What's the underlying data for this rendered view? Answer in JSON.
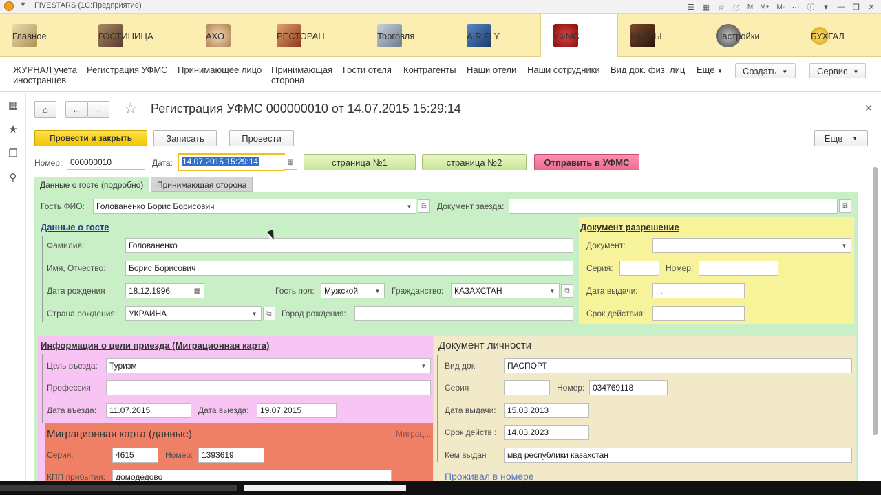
{
  "window": {
    "title": "FIVESTARS (1С:Предприятие)",
    "title_icons": [
      "nav-icon",
      "calendar-icon",
      "star-icon",
      "history-icon",
      "M",
      "M+",
      "M-",
      "ellipsis-icon",
      "info-icon",
      "dropdown-icon",
      "minimize-icon",
      "restore-icon",
      "close-icon"
    ]
  },
  "sections": [
    {
      "label": "Главное",
      "icon": "home-desk-icon",
      "color": "#c8b070"
    },
    {
      "label": "ГОСТИНИЦА",
      "icon": "hotel-icon",
      "color": "#8a6a4a"
    },
    {
      "label": "АХО",
      "icon": "maid-icon",
      "color": "#d9b890"
    },
    {
      "label": "РЕСТОРАН",
      "icon": "dish-icon",
      "color": "#b0603a"
    },
    {
      "label": "Торговля",
      "icon": "store-icon",
      "color": "#8c9aa8"
    },
    {
      "label": "AIR FLY",
      "icon": "plane-icon",
      "color": "#2a5a9a"
    },
    {
      "label": "УФМС",
      "icon": "emblem-icon",
      "color": "#b02020",
      "active": true
    },
    {
      "label": "КАДРЫ",
      "icon": "book-icon",
      "color": "#5a2a1a"
    },
    {
      "label": "Настройки",
      "icon": "gear-icon",
      "color": "#606060"
    },
    {
      "label": "БУХГАЛ",
      "icon": "coin-icon",
      "color": "#e0b020"
    }
  ],
  "nav": {
    "items": [
      {
        "label": "ЖУРНАЛ учета иностранцев"
      },
      {
        "label": "Регистрация УФМС"
      },
      {
        "label": "Принимающее лицо"
      },
      {
        "label": "Принимающая сторона"
      },
      {
        "label": "Гости отеля"
      },
      {
        "label": "Контрагенты"
      },
      {
        "label": "Наши отели"
      },
      {
        "label": "Наши сотрудники"
      },
      {
        "label": "Вид док. физ. лиц"
      }
    ],
    "more_label": "Еще",
    "create_label": "Создать",
    "service_label": "Сервис"
  },
  "rail": [
    "apps-grid-icon",
    "favorites-star-icon",
    "history-icon",
    "search-icon"
  ],
  "form": {
    "title": "Регистрация УФМС 000000010 от 14.07.2015 15:29:14",
    "buttons": {
      "post_close": "Провести и закрыть",
      "save": "Записать",
      "post": "Провести",
      "more": "Еще",
      "page1": "страница №1",
      "page2": "страница №2",
      "send": "Отправить в УФМС"
    },
    "number_label": "Номер:",
    "number_value": "000000010",
    "date_label": "Дата:",
    "date_value": "14.07.2015 15:29:14",
    "tabs": [
      "Данные о госте (подробно)",
      "Принимающая сторона"
    ],
    "guest_label": "Гость ФИО:",
    "guest_value": "Голованенко Борис Борисович",
    "arrival_doc_label": "Документ заезда:",
    "arrival_doc_value": "",
    "guest_section": {
      "title": "Данные о госте",
      "lastname_label": "Фамилия:",
      "lastname_value": "Голованенко",
      "name_label": "Имя, Отчество:",
      "name_value": "Борис Борисович",
      "birthdate_label": "Дата рождения",
      "birthdate_value": "18.12.1996",
      "gender_label": "Гость пол:",
      "gender_value": "Мужской",
      "citizenship_label": "Гражданство:",
      "citizenship_value": "КАЗАХСТАН",
      "birth_country_label": "Страна рождения:",
      "birth_country_value": "УКРАИНА",
      "birth_city_label": "Город рождения:",
      "birth_city_value": ""
    },
    "permit_section": {
      "title": "Документ разрешение",
      "doc_label": "Документ:",
      "doc_value": "",
      "series_label": "Серия:",
      "series_value": "",
      "number_label": "Номер:",
      "number_value": "",
      "issue_label": "Дата выдачи:",
      "issue_value": " .  . ",
      "valid_label": "Срок действия:",
      "valid_value": " .  . "
    },
    "visit_section": {
      "title": "Информация о цели приезда (Миграционная карта)",
      "purpose_label": "Цель въезда:",
      "purpose_value": "Туризм",
      "profession_label": "Профессия",
      "profession_value": "",
      "entry_label": "Дата въезда:",
      "entry_value": "11.07.2015",
      "exit_label": "Дата выезда:",
      "exit_value": "19.07.2015"
    },
    "migration_section": {
      "title": "Миграционная карта (данные)",
      "side_label": "Миграц...",
      "series_label": "Серия:",
      "series_value": "4615",
      "number_label": "Номер:",
      "number_value": "1393619",
      "kpp_label": "КПП прибытия:",
      "kpp_value": "домодедово"
    },
    "identity_section": {
      "title": "Документ личности",
      "doctype_label": "Вид док",
      "doctype_value": "ПАСПОРТ",
      "series_label": "Серия",
      "series_value": "",
      "number_label": "Номер:",
      "number_value": "034769118",
      "issue_label": "Дата выдачи:",
      "issue_value": "15.03.2013",
      "valid_label": "Срок действ.:",
      "valid_value": "14.03.2023",
      "issuer_label": "Кем выдан",
      "issuer_value": "мвд республики казахстан",
      "room_link": "Проживал в номере"
    }
  }
}
